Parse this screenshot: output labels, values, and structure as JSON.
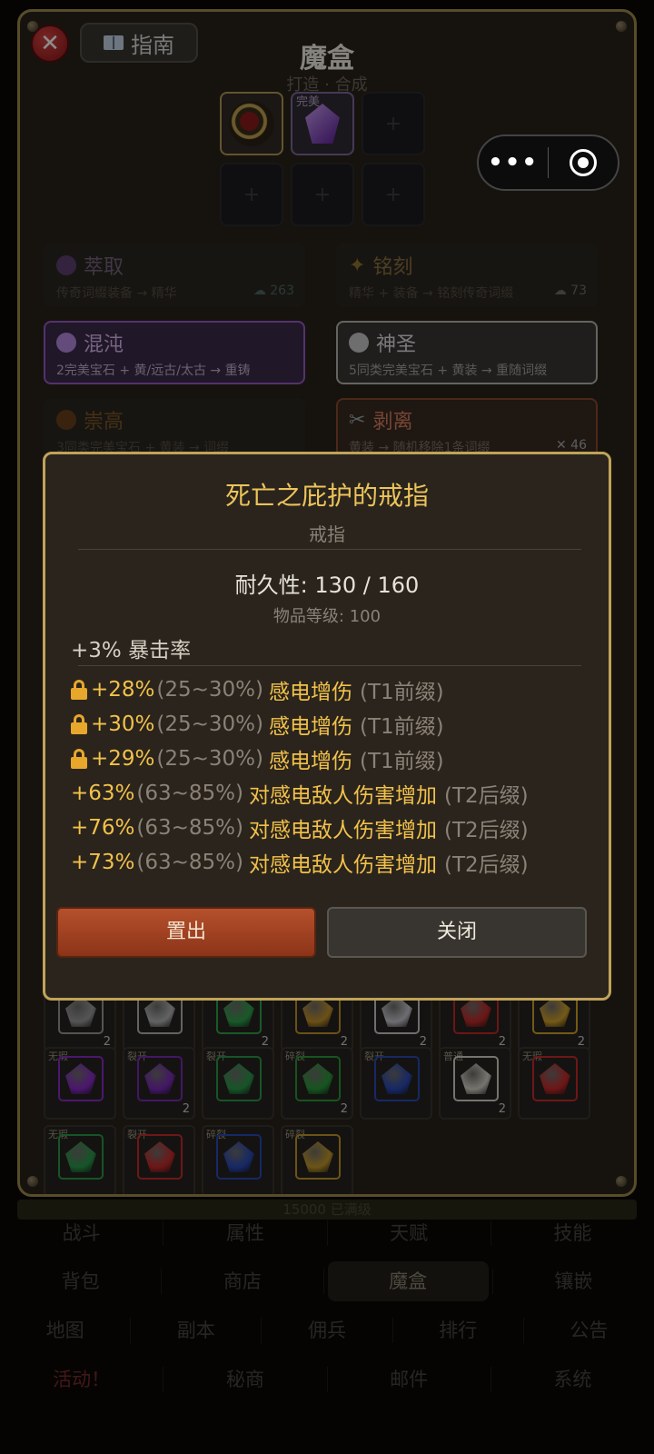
{
  "header": {
    "guide_label": "指南",
    "title": "魔盒",
    "subtitle": "打造 · 合成"
  },
  "slots": {
    "empty_symbol": "+",
    "perfect_tag": "完美"
  },
  "recipes": [
    {
      "name": "萃取",
      "desc": "传奇词缀装备 → 精华",
      "count": "263",
      "icon": "purple-orb-icon"
    },
    {
      "name": "铭刻",
      "desc": "精华 + 装备 → 铭刻传奇词缀",
      "count": "73",
      "icon": "sparkle-icon"
    },
    {
      "name": "混沌",
      "desc": "2完美宝石 + 黄/远古/太古 → 重铸",
      "icon": "chaos-orb-icon"
    },
    {
      "name": "神圣",
      "desc": "5同类完美宝石 + 黄装 → 重随词缀",
      "icon": "holy-orb-icon"
    },
    {
      "name": "崇高",
      "desc": "3同类完美宝石 + 黄装 → 词缀",
      "icon": "exalted-orb-icon"
    },
    {
      "name": "剥离",
      "desc": "黄装 → 随机移除1条词缀",
      "count": "46",
      "icon": "scissors-icon"
    }
  ],
  "bag": {
    "row1": [
      {
        "qty": "2",
        "color": "#9a9a9a",
        "icon": "silver-gem-icon"
      },
      {
        "qty": "",
        "color": "#b4b4b4",
        "icon": "silver-gem-icon"
      },
      {
        "qty": "2",
        "color": "#2fa24a",
        "icon": "emerald-icon"
      },
      {
        "qty": "2",
        "color": "#c4922a",
        "icon": "topaz-icon"
      },
      {
        "qty": "2",
        "color": "#c8c8d0",
        "icon": "diamond-icon"
      },
      {
        "qty": "2",
        "color": "#c22a2a",
        "icon": "ruby-icon"
      },
      {
        "qty": "2",
        "color": "#d4a22a",
        "icon": "gold-gem-icon"
      }
    ],
    "row2": [
      {
        "tag": "无瑕",
        "qty": "",
        "color": "#8a2ac8",
        "icon": "amethyst-icon"
      },
      {
        "tag": "裂开",
        "qty": "2",
        "color": "#7a2ab8",
        "icon": "amethyst-icon"
      },
      {
        "tag": "裂开",
        "qty": "",
        "color": "#2a9a4a",
        "icon": "emerald-icon"
      },
      {
        "tag": "碎裂",
        "qty": "2",
        "color": "#2a9a3a",
        "icon": "emerald-icon"
      },
      {
        "tag": "裂开",
        "qty": "",
        "color": "#2a4ab8",
        "icon": "sapphire-icon"
      },
      {
        "tag": "普通",
        "qty": "2",
        "color": "#d8d4c8",
        "icon": "skull-icon"
      },
      {
        "tag": "无瑕",
        "qty": "",
        "color": "#c82a2a",
        "icon": "ruby-icon"
      }
    ],
    "row3": [
      {
        "tag": "无瑕",
        "color": "#2a9a4a"
      },
      {
        "tag": "裂开",
        "color": "#c82a2a"
      },
      {
        "tag": "碎裂",
        "color": "#2a4ab8"
      },
      {
        "tag": "碎裂",
        "color": "#c49a2a"
      }
    ],
    "capacity": "15000 已满级"
  },
  "nav": {
    "row1": [
      "战斗",
      "属性",
      "天赋",
      "技能"
    ],
    "row2": [
      "背包",
      "商店",
      "魔盒",
      "镶嵌"
    ],
    "row3": [
      "地图",
      "副本",
      "佣兵",
      "排行",
      "公告"
    ],
    "row4": [
      "活动！",
      "秘商",
      "邮件",
      "系统"
    ],
    "active": "魔盒"
  },
  "tooltip": {
    "name": "死亡之庇护的戒指",
    "type": "戒指",
    "durability": "耐久性: 130 / 160",
    "item_level": "物品等级: 100",
    "implicit": "+3% 暴击率",
    "affixes": [
      {
        "locked": true,
        "value": "+28%",
        "range": "(25~30%)",
        "stat": "感电增伤",
        "tier": "(T1前缀)"
      },
      {
        "locked": true,
        "value": "+30%",
        "range": "(25~30%)",
        "stat": "感电增伤",
        "tier": "(T1前缀)"
      },
      {
        "locked": true,
        "value": "+29%",
        "range": "(25~30%)",
        "stat": "感电增伤",
        "tier": "(T1前缀)"
      },
      {
        "locked": false,
        "value": "+63%",
        "range": "(63~85%)",
        "stat": "对感电敌人伤害增加",
        "tier": "(T2后缀)"
      },
      {
        "locked": false,
        "value": "+76%",
        "range": "(63~85%)",
        "stat": "对感电敌人伤害增加",
        "tier": "(T2后缀)"
      },
      {
        "locked": false,
        "value": "+73%",
        "range": "(63~85%)",
        "stat": "对感电敌人伤害增加",
        "tier": "(T2后缀)"
      }
    ],
    "btn_out": "置出",
    "btn_close": "关闭"
  }
}
